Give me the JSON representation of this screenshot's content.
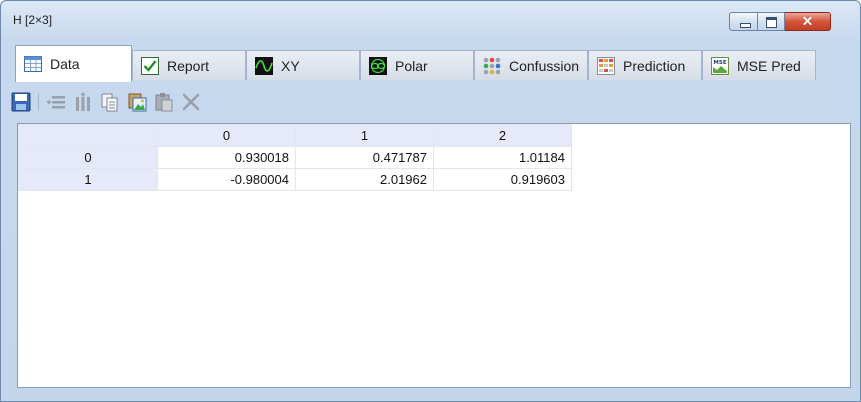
{
  "window": {
    "title": "H [2×3]",
    "controls": {
      "close_glyph": "✕"
    }
  },
  "tabs": [
    {
      "label": "Data",
      "icon": "table-icon",
      "active": true
    },
    {
      "label": "Report",
      "icon": "check-icon",
      "active": false
    },
    {
      "label": "XY",
      "icon": "wave-icon",
      "active": false
    },
    {
      "label": "Polar",
      "icon": "polar-icon",
      "active": false
    },
    {
      "label": "Confussion",
      "icon": "confusion-dots-icon",
      "active": false
    },
    {
      "label": "Prediction",
      "icon": "prediction-grid-icon",
      "active": false
    },
    {
      "label": "MSE Pred",
      "icon": "mse-icon",
      "active": false
    }
  ],
  "tab_icon_texts": {
    "mse": "MSE"
  },
  "toolbar": {
    "buttons": [
      {
        "icon": "save-icon",
        "enabled": true
      },
      {
        "icon": "insert-row-icon",
        "enabled": false
      },
      {
        "icon": "insert-column-icon",
        "enabled": false
      },
      {
        "icon": "copy-icon",
        "enabled": false
      },
      {
        "icon": "paste-image-icon",
        "enabled": true
      },
      {
        "icon": "paste-icon",
        "enabled": false
      },
      {
        "icon": "delete-icon",
        "enabled": false
      }
    ]
  },
  "grid": {
    "columns": [
      "0",
      "1",
      "2"
    ],
    "rows": [
      {
        "label": "0",
        "values": [
          "0.930018",
          "0.471787",
          "1.01184"
        ]
      },
      {
        "label": "1",
        "values": [
          "-0.980004",
          "2.01962",
          "0.919603"
        ]
      }
    ]
  }
}
